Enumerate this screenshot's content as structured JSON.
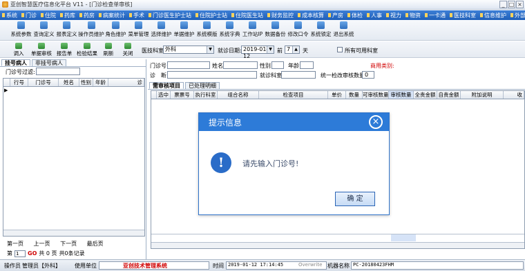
{
  "window": {
    "title": "亚创智慧医疗信息化平台 V11 - [门诊检查单审核]",
    "min": "_",
    "max": "□",
    "close": "×"
  },
  "menu": [
    "系统",
    "门诊",
    "住院",
    "药库",
    "药房",
    "病案统计",
    "手术",
    "门诊医生护士站",
    "住院护士站",
    "住院医生站",
    "财务监控",
    "成本核算",
    "产房",
    "体检",
    "人事",
    "视力",
    "物资",
    "一卡通",
    "医技科室",
    "信息维护",
    "外部卡管理"
  ],
  "toolbar1": [
    "系统参数",
    "查询定义",
    "报表定义",
    "操作员维护",
    "角色维护",
    "菜单管理",
    "选择维护",
    "单据维护",
    "系统模版",
    "系统字典",
    "工作站IP",
    "数据备份",
    "修改口令",
    "系统锁定",
    "退出系统"
  ],
  "toolbar2": {
    "buttons": [
      "调入",
      "单据审核",
      "报告单",
      "检验结果",
      "刷新",
      "关闭"
    ],
    "dept_label": "医技科室",
    "dept_value": "外科",
    "date_label": "就诊日期:",
    "date_value": "2019-01-12",
    "prev_label": "前",
    "days_value": "7",
    "days_unit": "天",
    "all_label": "所有可用科室"
  },
  "left": {
    "tabs": [
      "挂号病人",
      "非挂号病人"
    ],
    "filter_label": "门诊号过滤:",
    "columns": [
      "行号",
      "门诊号",
      "姓名",
      "性别",
      "年龄",
      "诊"
    ],
    "pager": [
      "第一页",
      "上一页",
      "下一页",
      "最后页"
    ],
    "page_prefix": "第",
    "page_value": "1",
    "page_go": "GO",
    "page_total": "共 0 页",
    "records": "共0条记录"
  },
  "right": {
    "fields": {
      "clinic_no": "门诊号",
      "name": "姓名",
      "sex": "性别",
      "age": "年龄",
      "diag": "诊　断",
      "dept": "就诊科室",
      "count_label": "统一检改审核数量",
      "count_value": "0",
      "fee_label": "商用类别:"
    },
    "tabs": [
      "需审核项目",
      "已处理明细"
    ],
    "columns": [
      "选中",
      "票票号",
      "执行科室",
      "组合名称",
      "检查项目",
      "单价",
      "数量",
      "可审核数量",
      "审核数量",
      "全责金额",
      "自责金额",
      "附加说明",
      "收"
    ]
  },
  "status": {
    "operator_label": "操作员",
    "operator_value": "管理员【外科】",
    "unit_label": "使用单位",
    "company": "亚创技术管理系统",
    "time_label": "时间",
    "time_value": "2019-01-12 17:14:45",
    "overwrite": "Overwrite",
    "machine_label": "机器名称",
    "machine_value": "PC-20180423FHM"
  },
  "dialog": {
    "title": "提示信息",
    "close": "×",
    "icon": "!",
    "message": "请先输入门诊号!",
    "ok": "确 定"
  },
  "colors": {
    "menu_bg": "#1f5fb8",
    "dialog_header": "#2d7bd8",
    "alert_red": "#d00000"
  }
}
